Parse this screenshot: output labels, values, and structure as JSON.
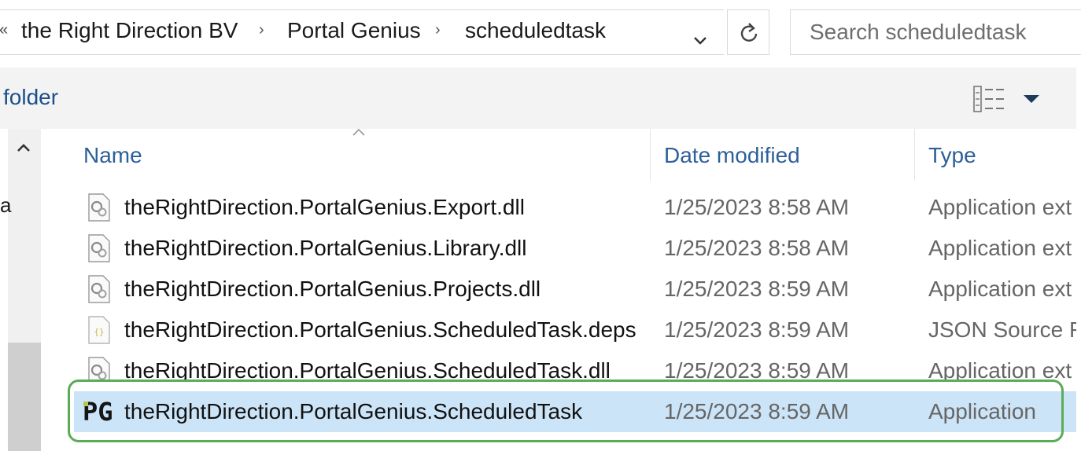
{
  "breadcrumb": {
    "items": [
      "the Right Direction BV",
      "Portal Genius",
      "scheduledtask"
    ]
  },
  "search": {
    "placeholder": "Search scheduledtask"
  },
  "command_band": {
    "folder_label": "folder"
  },
  "nav_pane": {
    "partial_label": "a"
  },
  "columns": {
    "name": "Name",
    "date_modified": "Date modified",
    "type": "Type"
  },
  "files": [
    {
      "icon": "dll-file-icon",
      "name": "theRightDirection.PortalGenius.Export.dll",
      "date": "1/25/2023 8:58 AM",
      "type": "Application ext"
    },
    {
      "icon": "dll-file-icon",
      "name": "theRightDirection.PortalGenius.Library.dll",
      "date": "1/25/2023 8:58 AM",
      "type": "Application ext"
    },
    {
      "icon": "dll-file-icon",
      "name": "theRightDirection.PortalGenius.Projects.dll",
      "date": "1/25/2023 8:59 AM",
      "type": "Application ext"
    },
    {
      "icon": "json-file-icon",
      "name": "theRightDirection.PortalGenius.ScheduledTask.deps",
      "date": "1/25/2023 8:59 AM",
      "type": "JSON Source Fi"
    },
    {
      "icon": "dll-file-icon",
      "name": "theRightDirection.PortalGenius.ScheduledTask.dll",
      "date": "1/25/2023 8:59 AM",
      "type": "Application ext"
    },
    {
      "icon": "portal-genius-app-icon",
      "name": "theRightDirection.PortalGenius.ScheduledTask",
      "date": "1/25/2023 8:59 AM",
      "type": "Application",
      "selected": true
    }
  ],
  "app_icon_glyph": "PG",
  "colors": {
    "selection": "#cce4f7",
    "highlight_frame": "#5aac56",
    "column_header": "#2d5f99",
    "folder_label": "#1a4f8b"
  }
}
